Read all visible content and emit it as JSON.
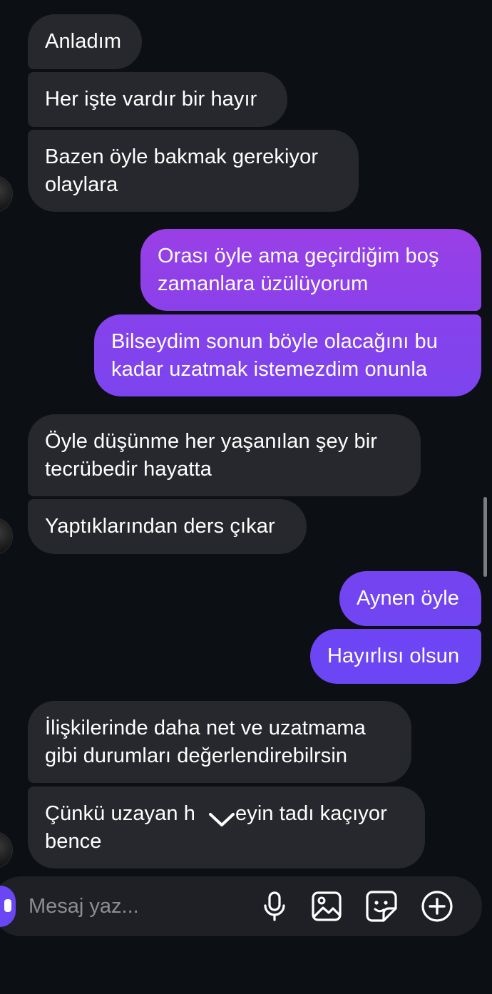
{
  "colors": {
    "background": "#0c0f14",
    "incoming_bubble": "#26282d",
    "outgoing_gradient_top": "#9a3fe6",
    "outgoing_gradient_bottom": "#6b46f5",
    "composer_bg": "#1e2025",
    "placeholder": "#8c8e94"
  },
  "messages": [
    {
      "direction": "in",
      "lines": [
        "Anladım"
      ]
    },
    {
      "direction": "in",
      "lines": [
        "Her işte vardır bir hayır"
      ]
    },
    {
      "direction": "in",
      "lines": [
        "Bazen öyle bakmak gerekiyor",
        "olaylara"
      ]
    },
    {
      "direction": "out",
      "lines": [
        "Orası öyle ama geçirdiğim boş",
        "zamanlara üzülüyorum"
      ]
    },
    {
      "direction": "out",
      "lines": [
        "Bilseydim sonun böyle olacağını bu",
        "kadar uzatmak istemezdim onunla"
      ]
    },
    {
      "direction": "in",
      "lines": [
        "Öyle düşünme her yaşanılan şey bir",
        "tecrübedir hayatta"
      ]
    },
    {
      "direction": "in",
      "lines": [
        "Yaptıklarından ders çıkar"
      ]
    },
    {
      "direction": "out",
      "lines": [
        "Aynen öyle"
      ]
    },
    {
      "direction": "out",
      "lines": [
        "Hayırlısı olsun"
      ]
    },
    {
      "direction": "in",
      "lines": [
        "İlişkilerinde daha net ve uzatmama",
        "gibi durumları değerlendirebilrsin"
      ]
    },
    {
      "direction": "in",
      "lines": [
        "Çünkü uzayan h",
        "eyin tadı kaçıyor",
        "bence"
      ]
    }
  ],
  "composer": {
    "placeholder": "Mesaj yaz...",
    "icons": [
      "camera-icon",
      "microphone-icon",
      "image-icon",
      "sticker-icon",
      "plus-circle-icon"
    ]
  },
  "jump_to_latest_icon": "chevron-down-icon"
}
